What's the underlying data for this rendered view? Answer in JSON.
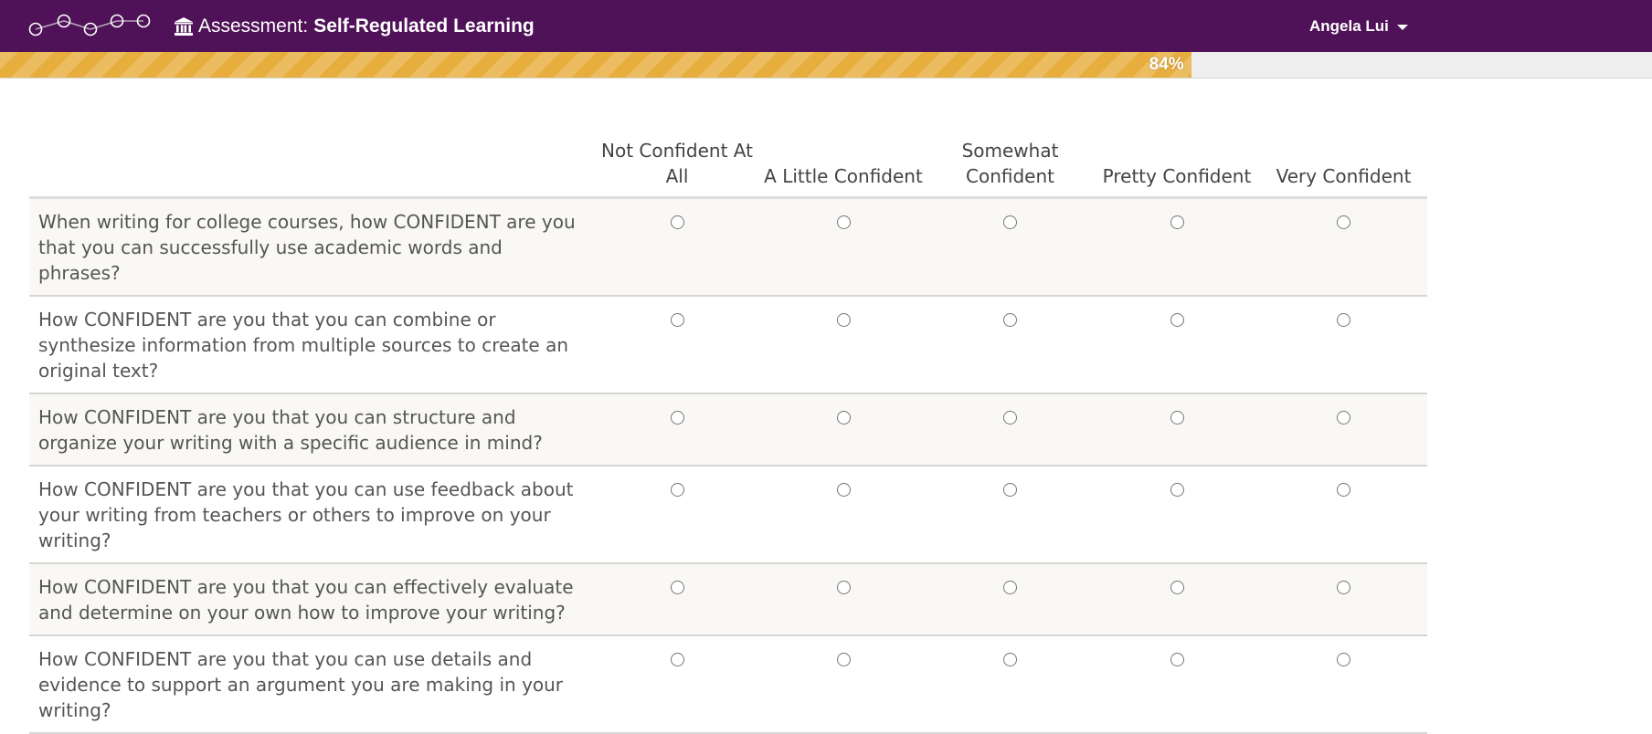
{
  "header": {
    "title_prefix": "Assessment:",
    "title_bold": "Self-Regulated Learning",
    "user_name": "Angela Lui",
    "background_color": "#4f1157"
  },
  "progress": {
    "value_percent": 84,
    "label": "84%",
    "fill_color": "#e7ad3d"
  },
  "survey": {
    "columns": [
      "Not Confident At All",
      "A Little Confident",
      "Somewhat Confident",
      "Pretty Confident",
      "Very Confident"
    ],
    "questions": [
      "When writing for college courses, how CONFIDENT are you that you can successfully use academic words and phrases?",
      "How CONFIDENT are you that you can combine or synthesize information from multiple sources to create an original text?",
      "How CONFIDENT are you that you can structure and organize your writing with a specific audience in mind?",
      "How CONFIDENT are you that you can use feedback about your writing from teachers or others to improve on your writing?",
      "How CONFIDENT are you that you can effectively evaluate and determine on your own how to improve your writing?",
      "How CONFIDENT are you that you can use details and evidence to support an argument you are making in your writing?"
    ]
  },
  "icons": {
    "logo": "network-dots-logo",
    "title_icon": "bank-building-icon",
    "user_menu": "caret-down-icon"
  }
}
